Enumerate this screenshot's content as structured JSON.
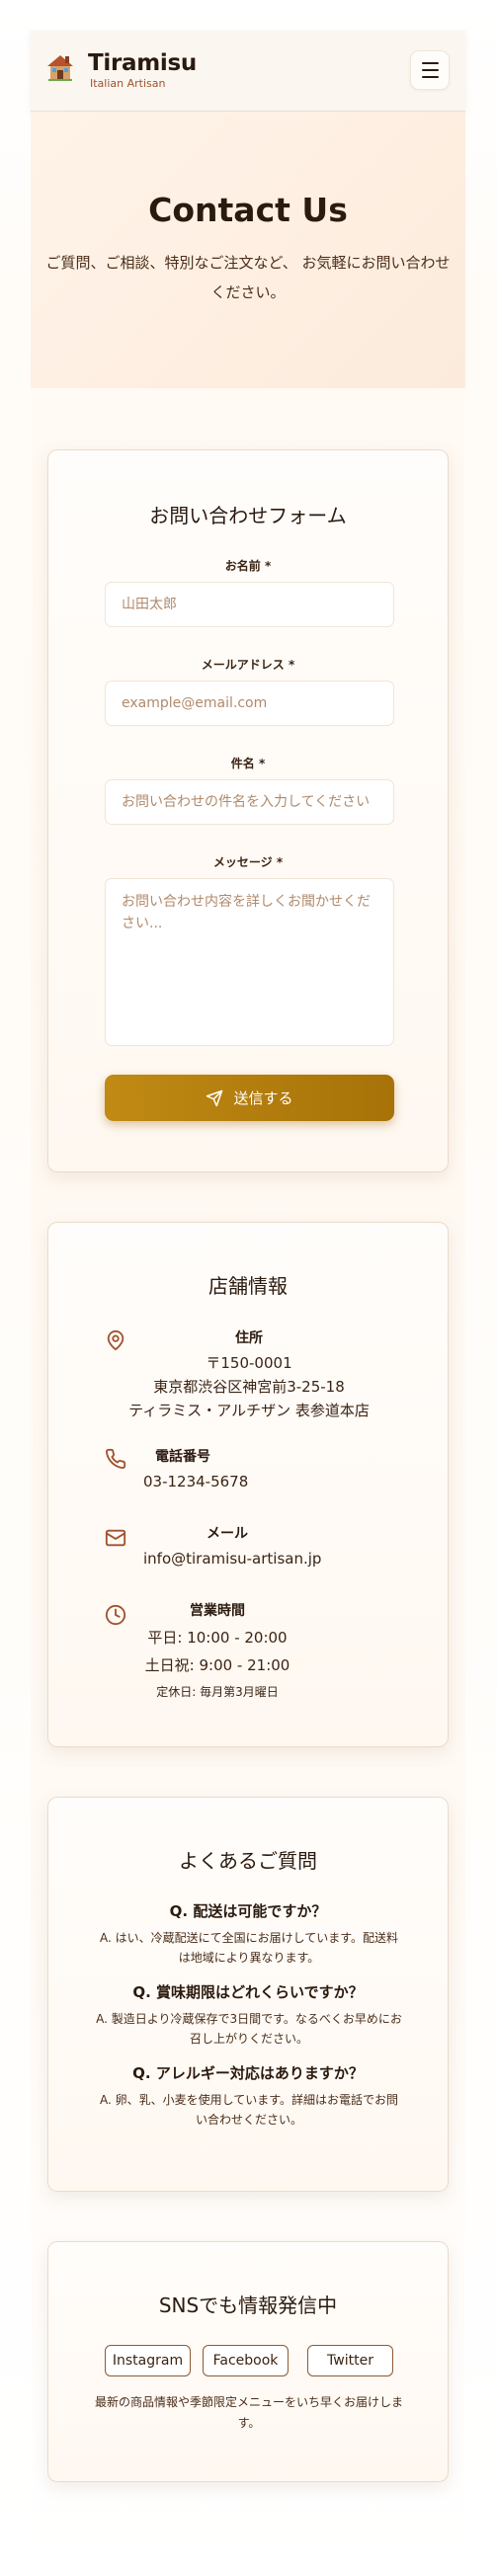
{
  "header": {
    "brand_name": "Tiramisu",
    "brand_sub": "Italian Artisan",
    "logo_icon": "house-icon",
    "menu_icon": "hamburger-menu-icon"
  },
  "hero": {
    "title": "Contact Us",
    "subtitle": "ご質問、ご相談、特別なご注文など、 お気軽にお問い合わせください。"
  },
  "form": {
    "title": "お問い合わせフォーム",
    "name_label": "お名前 *",
    "name_placeholder": "山田太郎",
    "email_label": "メールアドレス *",
    "email_placeholder": "example@email.com",
    "subject_label": "件名 *",
    "subject_placeholder": "お問い合わせの件名を入力してください",
    "message_label": "メッセージ *",
    "message_placeholder": "お問い合わせ内容を詳しくお聞かせください...",
    "submit_label": "送信する",
    "submit_icon": "send-icon"
  },
  "store": {
    "title": "店舗情報",
    "address_heading": "住所",
    "address_zip": "〒150-0001",
    "address_line1": "東京都渋谷区神宮前3-25-18",
    "address_line2": "ティラミス・アルチザン 表参道本店",
    "phone_heading": "電話番号",
    "phone": "03-1234-5678",
    "email_heading": "メール",
    "email": "info@tiramisu-artisan.jp",
    "hours_heading": "営業時間",
    "hours_weekday": "平日: 10:00 - 20:00",
    "hours_weekend": "土日祝: 9:00 - 21:00",
    "closed": "定休日: 毎月第3月曜日"
  },
  "faq": {
    "title": "よくあるご質問",
    "items": [
      {
        "q": "Q. 配送は可能ですか？",
        "a": "A. はい、冷蔵配送にて全国にお届けしています。配送料は地域により異なります。"
      },
      {
        "q": "Q. 賞味期限はどれくらいですか？",
        "a": "A. 製造日より冷蔵保存で3日間です。なるべくお早めにお召し上がりください。"
      },
      {
        "q": "Q. アレルギー対応はありますか？",
        "a": "A. 卵、乳、小麦を使用しています。詳細はお電話でお問い合わせください。"
      }
    ]
  },
  "sns": {
    "title": "SNSでも情報発信中",
    "buttons": [
      "Instagram",
      "Facebook",
      "Twitter"
    ],
    "description": "最新の商品情報や季節限定メニューをいち早くお届けします。"
  },
  "colors": {
    "accent": "#b07d0e",
    "icon": "#a0522d",
    "text": "#3b2414"
  }
}
